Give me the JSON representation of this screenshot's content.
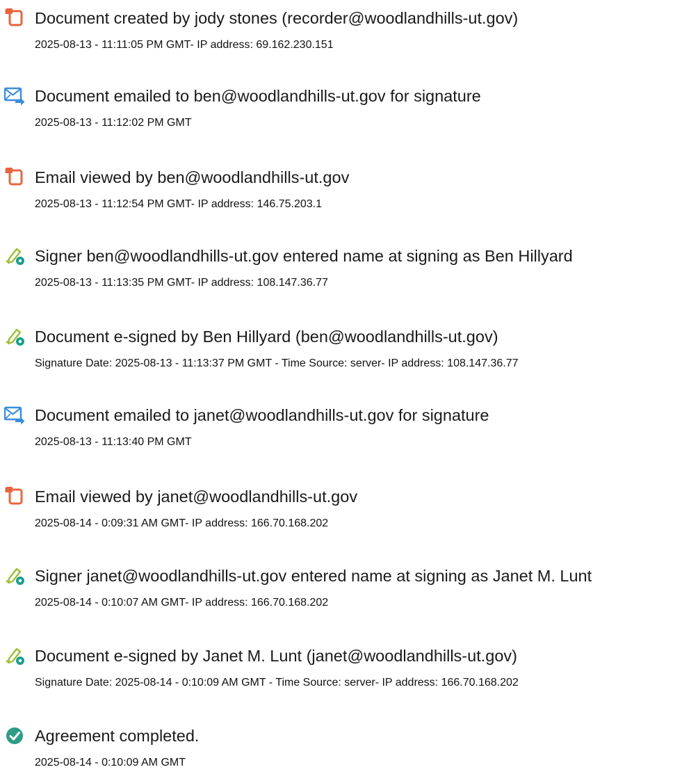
{
  "colors": {
    "document_icon": "#e8643d",
    "email_icon": "#3a8dde",
    "signature_pen": "#9fbf3b",
    "signature_badge": "#1a9e8f",
    "completed_icon": "#2e9c86"
  },
  "events": [
    {
      "icon": "document-icon",
      "title": "Document created by jody stones (recorder@woodlandhills-ut.gov)",
      "detail": "2025-08-13 - 11:11:05 PM GMT- IP address: 69.162.230.151"
    },
    {
      "icon": "email-send-icon",
      "title": "Document emailed to ben@woodlandhills-ut.gov for signature",
      "detail": "2025-08-13 - 11:12:02 PM GMT"
    },
    {
      "icon": "document-icon",
      "title": "Email viewed by ben@woodlandhills-ut.gov",
      "detail": "2025-08-13 - 11:12:54 PM GMT- IP address: 146.75.203.1"
    },
    {
      "icon": "signature-pen-icon",
      "title": "Signer ben@woodlandhills-ut.gov entered name at signing as Ben Hillyard",
      "detail": "2025-08-13 - 11:13:35 PM GMT- IP address: 108.147.36.77"
    },
    {
      "icon": "signature-pen-icon",
      "title": "Document e-signed by Ben Hillyard (ben@woodlandhills-ut.gov)",
      "detail": "Signature Date: 2025-08-13 - 11:13:37 PM GMT - Time Source: server- IP address: 108.147.36.77"
    },
    {
      "icon": "email-send-icon",
      "title": "Document emailed to janet@woodlandhills-ut.gov for signature",
      "detail": "2025-08-13 - 11:13:40 PM GMT"
    },
    {
      "icon": "document-icon",
      "title": "Email viewed by janet@woodlandhills-ut.gov",
      "detail": "2025-08-14 - 0:09:31 AM GMT- IP address: 166.70.168.202"
    },
    {
      "icon": "signature-pen-icon",
      "title": "Signer janet@woodlandhills-ut.gov entered name at signing as Janet M. Lunt",
      "detail": "2025-08-14 - 0:10:07 AM GMT- IP address: 166.70.168.202"
    },
    {
      "icon": "signature-pen-icon",
      "title": "Document e-signed by Janet M. Lunt (janet@woodlandhills-ut.gov)",
      "detail": "Signature Date: 2025-08-14 - 0:10:09 AM GMT - Time Source: server- IP address: 166.70.168.202"
    },
    {
      "icon": "check-circle-icon",
      "title": "Agreement completed.",
      "detail": "2025-08-14 - 0:10:09 AM GMT"
    }
  ]
}
